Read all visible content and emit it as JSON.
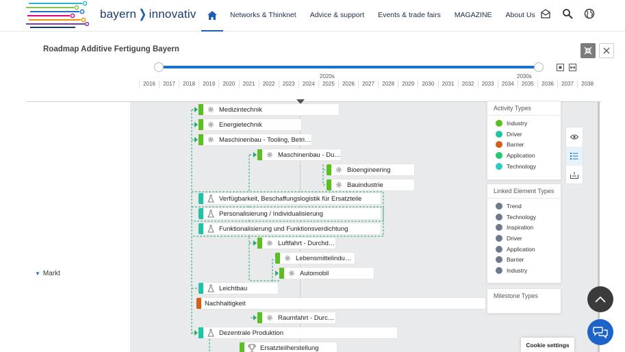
{
  "header": {
    "brand_left": "bayern",
    "brand_sep": "❭",
    "brand_right": "innovativ",
    "nav": [
      "Networks & Thinknet",
      "Advice & support",
      "Events & trade fairs",
      "MAGAZINE",
      "About Us"
    ]
  },
  "roadmap": {
    "title": "Roadmap Additive Fertigung Bayern",
    "decades": [
      "2020s",
      "2030s"
    ],
    "years": [
      "2016",
      "2017",
      "2018",
      "2019",
      "2020",
      "2021",
      "2022",
      "2023",
      "2024",
      "2025",
      "2026",
      "2027",
      "2028",
      "2029",
      "2030",
      "2031",
      "2032",
      "2033",
      "2034",
      "2035",
      "2036",
      "2037",
      "2038"
    ],
    "lane_label": "Markt"
  },
  "items": [
    {
      "label": "Medizintechnik",
      "color": "#5bbf21",
      "icon": "gear-icon"
    },
    {
      "label": "Energietechnik",
      "color": "#5bbf21",
      "icon": "gear-icon"
    },
    {
      "label": "Maschinenbau - Tooling, Betrie...",
      "color": "#5bbf21",
      "icon": "gear-icon"
    },
    {
      "label": "Maschinenbau - Durc...",
      "color": "#5bbf21",
      "icon": "gear-icon"
    },
    {
      "label": "Bioengineering",
      "color": "#5bbf21",
      "icon": "gear-icon"
    },
    {
      "label": "Bauindustrie",
      "color": "#5bbf21",
      "icon": "gear-icon"
    },
    {
      "label": "Verfügbarkeit, Beschaffungslogistik für Ersatzteile",
      "color": "#1fc4a4",
      "icon": "flask-icon"
    },
    {
      "label": "Personalisierung / Individualisierung",
      "color": "#1fc4a4",
      "icon": "flask-icon"
    },
    {
      "label": "Funktionalisierung und Funktionsverdichtung",
      "color": "#1fc4a4",
      "icon": "flask-icon"
    },
    {
      "label": "Luftfahrt - Durchdr...",
      "color": "#5bbf21",
      "icon": "gear-icon"
    },
    {
      "label": "Lebensmittelindust...",
      "color": "#5bbf21",
      "icon": "gear-icon"
    },
    {
      "label": "Automobil",
      "color": "#5bbf21",
      "icon": "gear-icon"
    },
    {
      "label": "Leichtbau",
      "color": "#1fc4a4",
      "icon": "flask-icon"
    },
    {
      "label": "Nachhaltigkeit",
      "color": "#d35f1a",
      "icon": "none"
    },
    {
      "label": "Raumfahrt - Durch...",
      "color": "#5bbf21",
      "icon": "gear-icon"
    },
    {
      "label": "Dezentrale Produktion",
      "color": "#1fc4a4",
      "icon": "flask-icon"
    },
    {
      "label": "Ersatzteilherstellung",
      "color": "#5bbf21",
      "icon": "trophy-icon"
    }
  ],
  "legend": {
    "activity_title": "Activity Types",
    "activity": [
      {
        "label": "Industry",
        "color": "#5bbf21"
      },
      {
        "label": "Driver",
        "color": "#1fc4a4"
      },
      {
        "label": "Barrier",
        "color": "#d35f1a"
      },
      {
        "label": "Application",
        "color": "#2bc46e"
      },
      {
        "label": "Technology",
        "color": "#2ec9c4"
      }
    ],
    "linked_title": "Linked Element Types",
    "linked": [
      "Trend",
      "Technology",
      "Inspiration",
      "Driver",
      "Application",
      "Barrier",
      "Industry"
    ],
    "milestone_title": "Milestone Types"
  },
  "cookie": "Cookie settings"
}
